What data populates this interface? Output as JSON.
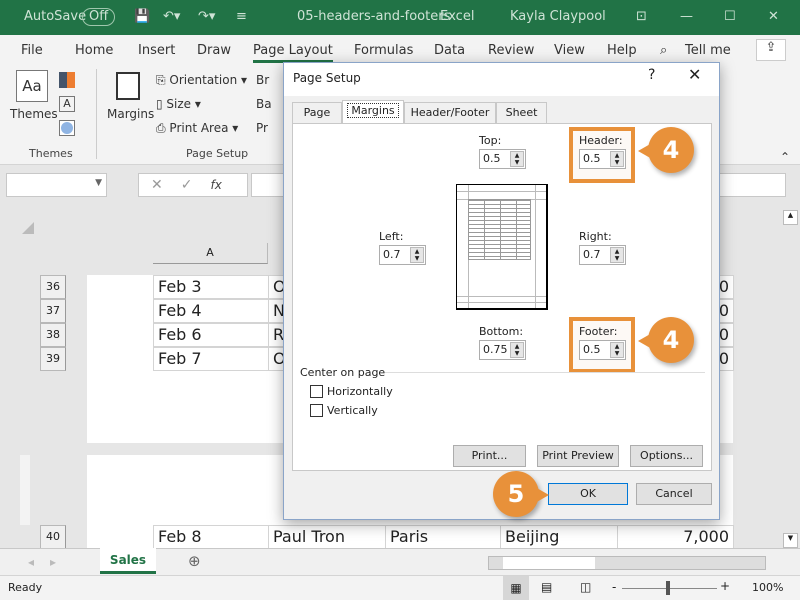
{
  "titlebar": {
    "autosave": "AutoSave",
    "autosave_state": "Off",
    "filename": "05-headers-and-footers",
    "app": "Excel",
    "user": "Kayla Claypool",
    "accent": "#217346"
  },
  "tabs": [
    "File",
    "Home",
    "Insert",
    "Draw",
    "Page Layout",
    "Formulas",
    "Data",
    "Review",
    "View",
    "Help"
  ],
  "tell_me": "Tell me",
  "ribbon": {
    "themes": "Themes",
    "margins": "Margins",
    "orientation": "Orientation",
    "size": "Size",
    "print_area": "Print Area",
    "br": "Br",
    "ba": "Ba",
    "pr": "Pr",
    "group_themes": "Themes",
    "group_page_setup": "Page Setup"
  },
  "formula_bar": {
    "fx": "fx",
    "name_box": ""
  },
  "sheet": {
    "column_header": "A",
    "rows": [
      {
        "num": "36",
        "a": "Feb 3",
        "b": "O",
        "e": "0"
      },
      {
        "num": "37",
        "a": "Feb 4",
        "b": "N",
        "e": "0"
      },
      {
        "num": "38",
        "a": "Feb 6",
        "b": "R",
        "e": "0"
      },
      {
        "num": "39",
        "a": "Feb 7",
        "b": "O",
        "e": "0"
      }
    ],
    "row40": {
      "num": "40",
      "a": "Feb 8",
      "b": "Paul Tron",
      "c": "Paris",
      "d": "Beijing",
      "e": "7,000"
    }
  },
  "dialog": {
    "title": "Page Setup",
    "help": "?",
    "tabs": [
      "Page",
      "Margins",
      "Header/Footer",
      "Sheet"
    ],
    "active_tab": "Margins",
    "top_label": "Top:",
    "top": "0.5",
    "header_label": "Header:",
    "header": "0.5",
    "left_label": "Left:",
    "left": "0.7",
    "right_label": "Right:",
    "right": "0.7",
    "bottom_label": "Bottom:",
    "bottom": "0.75",
    "footer_label": "Footer:",
    "footer": "0.5",
    "center_on_page": "Center on page",
    "horizontally": "Horizontally",
    "vertically": "Vertically",
    "horizontally_checked": false,
    "vertically_checked": false,
    "print": "Print...",
    "print_preview": "Print Preview",
    "options": "Options...",
    "ok": "OK",
    "cancel": "Cancel"
  },
  "callouts": {
    "header_step": "4",
    "footer_step": "4",
    "ok_step": "5",
    "color": "#e8913a"
  },
  "sheet_tab": "Sales",
  "status": {
    "ready": "Ready",
    "zoom": "100%"
  }
}
